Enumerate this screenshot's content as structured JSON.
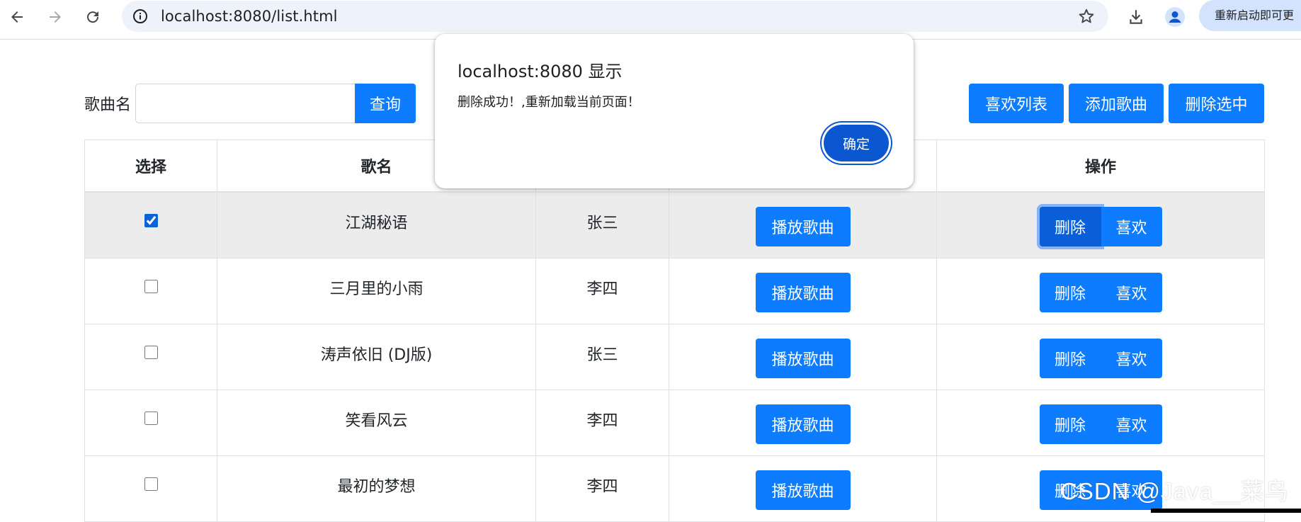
{
  "browser": {
    "url": "localhost:8080/list.html",
    "relaunch_label": "重新启动即可更"
  },
  "search": {
    "label": "歌曲名",
    "value": "",
    "placeholder": "",
    "button_label": "查询"
  },
  "toolbar": {
    "favorites_label": "喜欢列表",
    "add_label": "添加歌曲",
    "delete_selected_label": "删除选中"
  },
  "table": {
    "headers": [
      "选择",
      "歌名",
      "",
      "",
      "操作"
    ],
    "play_label": "播放歌曲",
    "delete_label": "删除",
    "like_label": "喜欢",
    "rows": [
      {
        "title": "江湖秘语",
        "singer": "张三",
        "checked": true
      },
      {
        "title": "三月里的小雨",
        "singer": "李四",
        "checked": false
      },
      {
        "title": "涛声依旧 (DJ版)",
        "singer": "张三",
        "checked": false
      },
      {
        "title": "笑看风云",
        "singer": "李四",
        "checked": false
      },
      {
        "title": "最初的梦想",
        "singer": "李四",
        "checked": false
      }
    ]
  },
  "dialog": {
    "title": "localhost:8080 显示",
    "message": "删除成功！,重新加载当前页面！",
    "ok_label": "确定"
  },
  "watermark": "CSDN @Java__菜鸟",
  "colors": {
    "primary": "#0d7cff",
    "dialog_button": "#0b57d0",
    "highlight_row": "#ececec"
  }
}
